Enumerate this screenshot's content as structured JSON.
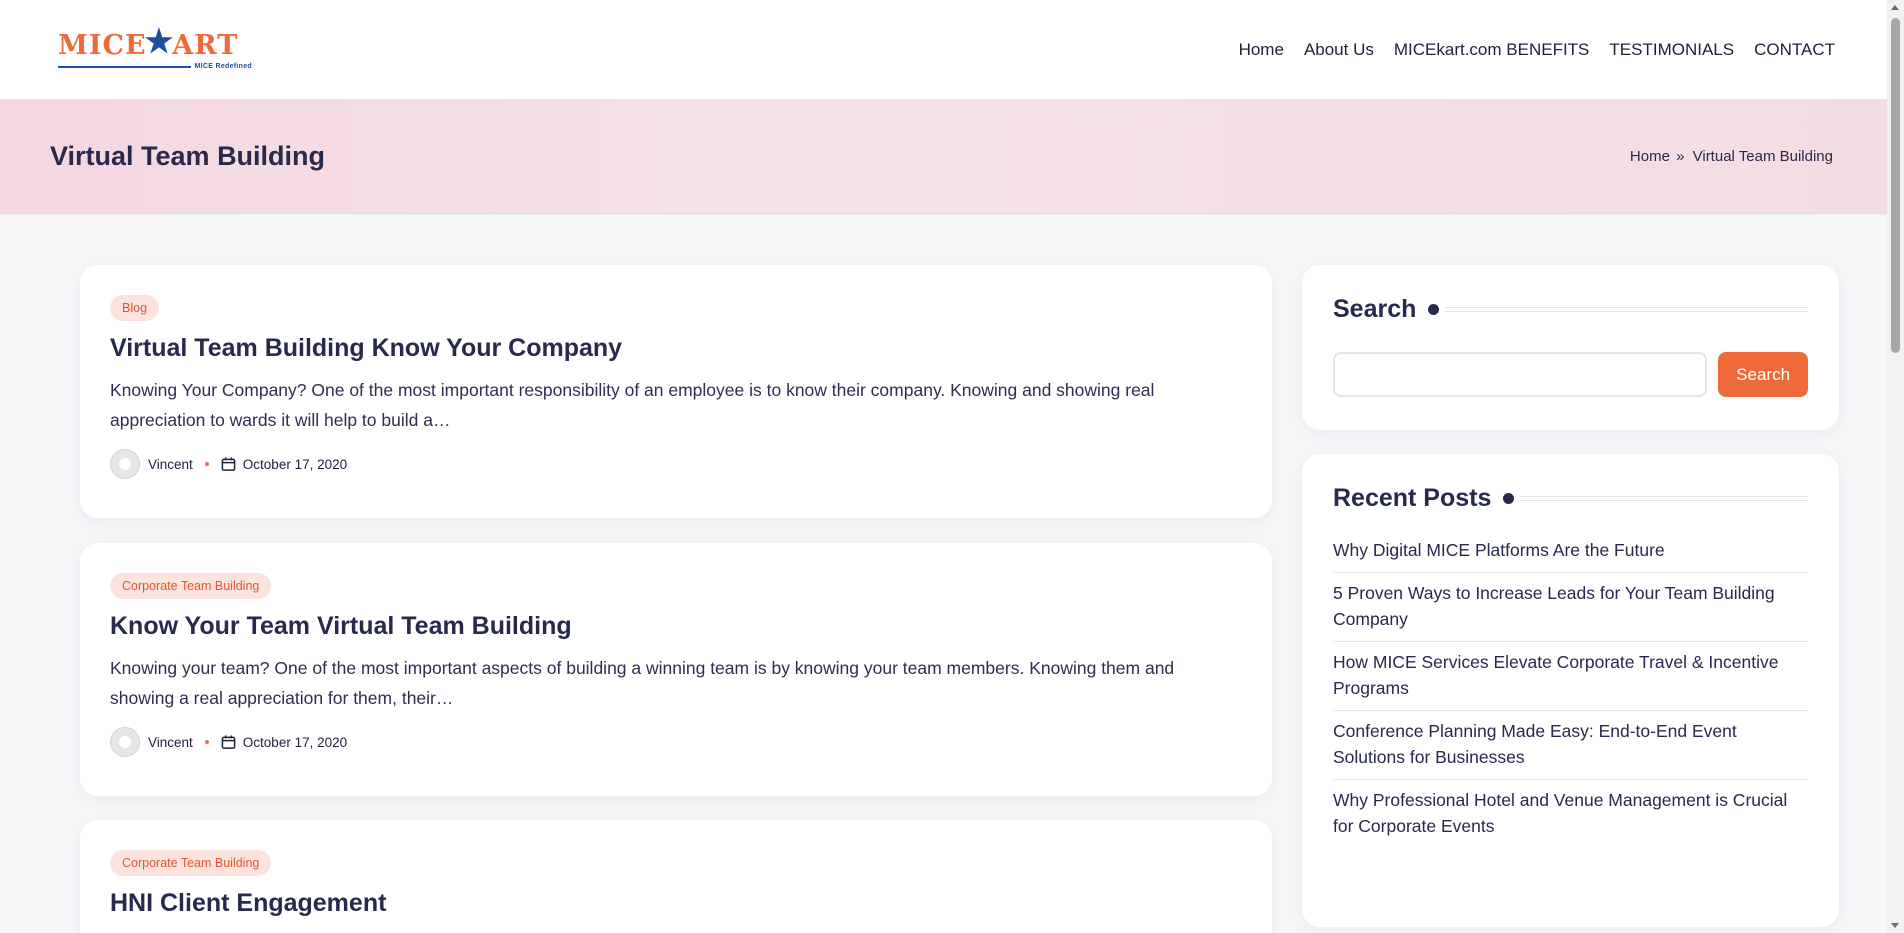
{
  "logo": {
    "text_left": "MICE",
    "text_right": "ART",
    "tagline": "MICE Redefined",
    "brand_color": "#ef6a3b",
    "accent_color": "#1f4f9c"
  },
  "nav": {
    "items": [
      {
        "label": "Home"
      },
      {
        "label": "About Us"
      },
      {
        "label": "MICEkart.com BENEFITS"
      },
      {
        "label": "TESTIMONIALS"
      },
      {
        "label": "CONTACT"
      }
    ]
  },
  "banner": {
    "title": "Virtual Team Building",
    "breadcrumb": {
      "home": "Home",
      "separator": "»",
      "current": "Virtual Team Building"
    }
  },
  "posts": [
    {
      "category": "Blog",
      "title": "Virtual Team Building Know Your Company",
      "excerpt": "Knowing Your Company? One of the most important responsibility of an employee is to know their company. Knowing and showing real appreciation to wards it will help to build a…",
      "author": "Vincent",
      "date": "October 17, 2020"
    },
    {
      "category": "Corporate Team Building",
      "title": "Know Your Team Virtual Team Building",
      "excerpt": "Knowing your team? One of the most important aspects of building a winning team is by knowing your team members. Knowing them and showing a real appreciation for them, their…",
      "author": "Vincent",
      "date": "October 17, 2020"
    },
    {
      "category": "Corporate Team Building",
      "title": "HNI Client Engagement"
    }
  ],
  "sidebar": {
    "search": {
      "title": "Search",
      "placeholder": "",
      "button_label": "Search"
    },
    "recent_posts": {
      "title": "Recent Posts",
      "items": [
        "Why Digital MICE Platforms Are the Future",
        "5 Proven Ways to Increase Leads for Your Team Building Company",
        "How MICE Services Elevate Corporate Travel & Incentive Programs",
        "Conference Planning Made Easy: End-to-End Event Solutions for Businesses",
        "Why Professional Hotel and Venue Management is Crucial for Corporate Events"
      ]
    }
  }
}
